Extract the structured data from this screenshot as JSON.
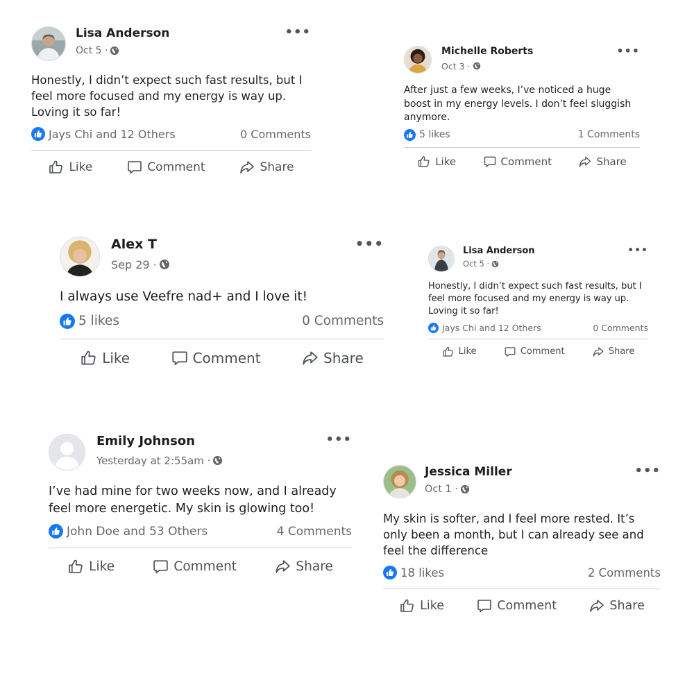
{
  "posts": [
    {
      "name": "Lisa Anderson",
      "date": "Oct 5 ·",
      "text": "Honestly, I didn’t expect such fast results, but I feel more focused and my energy is way up. Loving it so far!",
      "reactions": "Jays Chi and 12 Others",
      "comments": "0 Comments"
    },
    {
      "name": "Michelle Roberts",
      "date": "Oct 3 ·",
      "text": "After just a few weeks, I’ve noticed a huge boost in my energy levels. I don’t feel sluggish anymore.",
      "reactions": "5 likes",
      "comments": "1 Comments"
    },
    {
      "name": "Alex T",
      "date": "Sep 29 ·",
      "text": "I always use Veefre nad+ and I love it!",
      "reactions": "5 likes",
      "comments": "0 Comments"
    },
    {
      "name": "Lisa Anderson",
      "date": "Oct 5 ·",
      "text": "Honestly, I didn’t expect such fast results, but I feel more focused and my energy is way up. Loving it so far!",
      "reactions": "Jays Chi and 12 Others",
      "comments": "0 Comments"
    },
    {
      "name": "Emily Johnson",
      "date": "Yesterday at 2:55am ·",
      "text": "I’ve had mine for two weeks now, and I already feel more energetic. My skin is glowing too!",
      "reactions": "John Doe and 53 Others",
      "comments": "4 Comments"
    },
    {
      "name": "Jessica Miller",
      "date": "Oct 1 ·",
      "text": "My skin is softer, and I feel more rested. It’s only been a month, but I can already see and feel the difference",
      "reactions": "18 likes",
      "comments": "2 Comments"
    }
  ],
  "actions": {
    "like": "Like",
    "comment": "Comment",
    "share": "Share"
  },
  "menu_label": "•••",
  "colors": {
    "like_blue": "#1877f2",
    "muted": "#65676b",
    "divider": "#ced0d4"
  },
  "icons": {
    "more": "more-options-icon",
    "audience": "globe-icon",
    "reaction": "like-reaction-icon",
    "like": "thumbs-up-icon",
    "comment": "comment-bubble-icon",
    "share": "share-arrow-icon"
  }
}
